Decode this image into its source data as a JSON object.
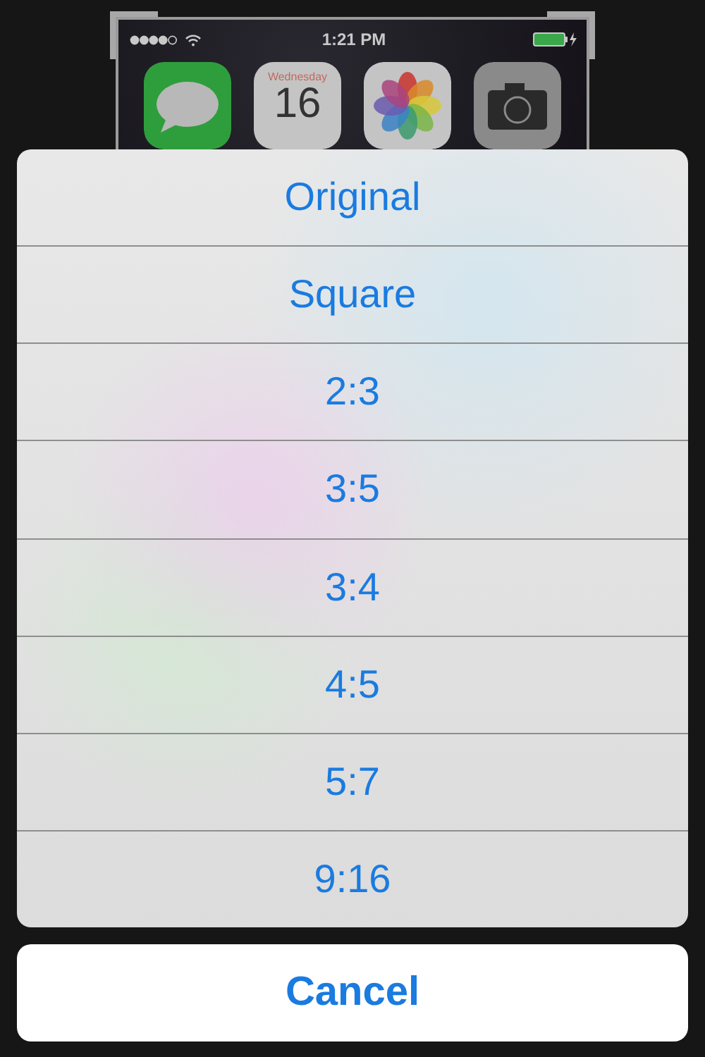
{
  "preview": {
    "status_bar": {
      "time": "1:21 PM"
    },
    "apps": [
      {
        "kind": "messages"
      },
      {
        "kind": "calendar",
        "day_name": "Wednesday",
        "day": "16"
      },
      {
        "kind": "photos"
      },
      {
        "kind": "camera"
      }
    ]
  },
  "action_sheet": {
    "options": [
      "Original",
      "Square",
      "2:3",
      "3:5",
      "3:4",
      "4:5",
      "5:7",
      "9:16"
    ]
  },
  "cancel_button": {
    "label": "Cancel"
  }
}
